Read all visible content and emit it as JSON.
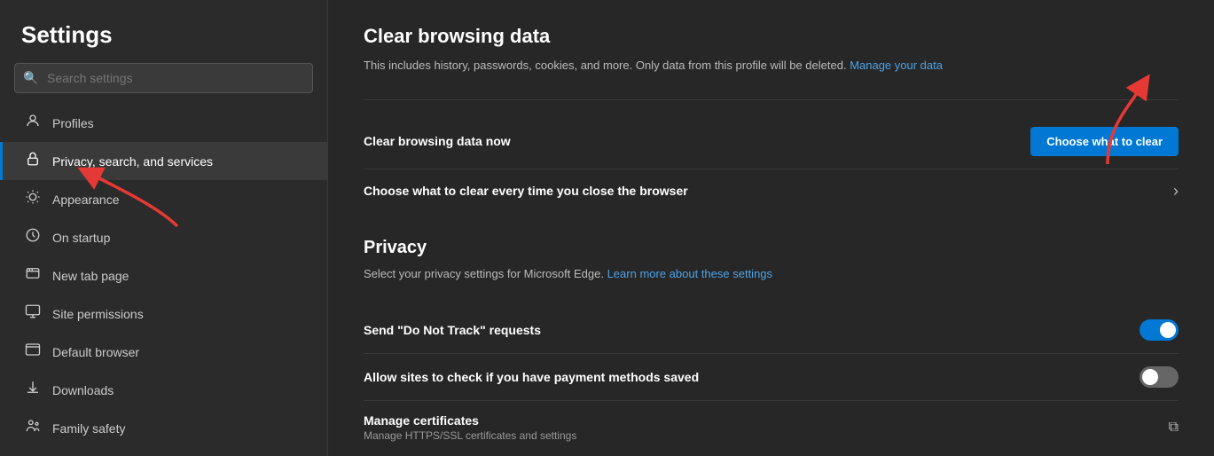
{
  "sidebar": {
    "title": "Settings",
    "search": {
      "placeholder": "Search settings",
      "value": ""
    },
    "items": [
      {
        "id": "profiles",
        "label": "Profiles",
        "icon": "👤",
        "active": false
      },
      {
        "id": "privacy",
        "label": "Privacy, search, and services",
        "icon": "🔒",
        "active": true
      },
      {
        "id": "appearance",
        "label": "Appearance",
        "icon": "🎨",
        "active": false
      },
      {
        "id": "on-startup",
        "label": "On startup",
        "icon": "⏻",
        "active": false
      },
      {
        "id": "new-tab",
        "label": "New tab page",
        "icon": "⊞",
        "active": false
      },
      {
        "id": "site-permissions",
        "label": "Site permissions",
        "icon": "⊟",
        "active": false
      },
      {
        "id": "default-browser",
        "label": "Default browser",
        "icon": "🖥",
        "active": false
      },
      {
        "id": "downloads",
        "label": "Downloads",
        "icon": "⬇",
        "active": false
      },
      {
        "id": "family-safety",
        "label": "Family safety",
        "icon": "👨‍👩‍👧",
        "active": false
      }
    ]
  },
  "main": {
    "clear_data": {
      "title": "Clear browsing data",
      "subtitle": "This includes history, passwords, cookies, and more. Only data from this profile will be deleted.",
      "manage_link": "Manage your data",
      "clear_now_label": "Clear browsing data now",
      "clear_now_button": "Choose what to clear",
      "clear_every_time_label": "Choose what to clear every time you close the browser"
    },
    "privacy": {
      "title": "Privacy",
      "subtitle": "Select your privacy settings for Microsoft Edge.",
      "learn_link": "Learn more about these settings",
      "settings": [
        {
          "id": "do-not-track",
          "label": "Send \"Do Not Track\" requests",
          "sublabel": "",
          "toggle": true,
          "enabled": true
        },
        {
          "id": "payment-methods",
          "label": "Allow sites to check if you have payment methods saved",
          "sublabel": "",
          "toggle": true,
          "enabled": false
        },
        {
          "id": "manage-certificates",
          "label": "Manage certificates",
          "sublabel": "Manage HTTPS/SSL certificates and settings",
          "external": true
        }
      ]
    }
  }
}
